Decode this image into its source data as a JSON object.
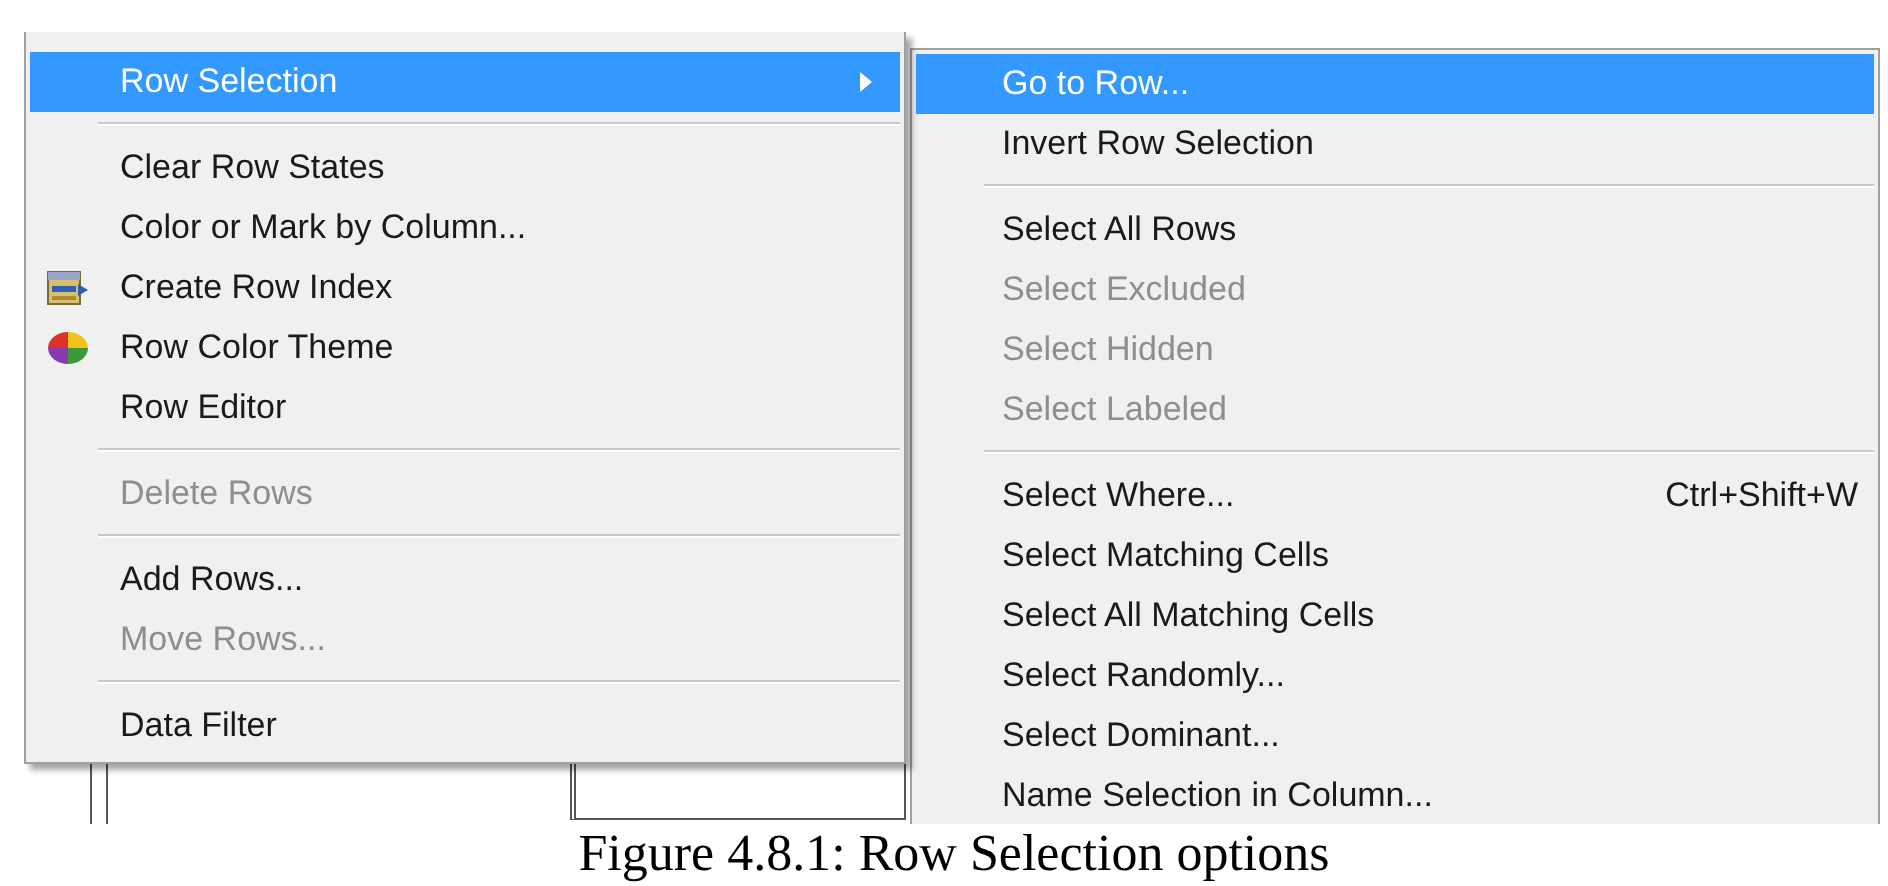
{
  "menu": {
    "items": [
      {
        "kind": "item",
        "label": "Row Selection",
        "selected": true,
        "disabled": false,
        "submenu": true
      },
      {
        "kind": "separator"
      },
      {
        "kind": "item",
        "label": "Clear Row States",
        "selected": false,
        "disabled": false
      },
      {
        "kind": "item",
        "label": "Color or Mark by Column...",
        "selected": false,
        "disabled": false
      },
      {
        "kind": "item",
        "label": "Create Row Index",
        "selected": false,
        "disabled": false
      },
      {
        "kind": "item",
        "label": "Row Color Theme",
        "selected": false,
        "disabled": false
      },
      {
        "kind": "item",
        "label": "Row Editor",
        "selected": false,
        "disabled": false
      },
      {
        "kind": "separator"
      },
      {
        "kind": "item",
        "label": "Delete Rows",
        "selected": false,
        "disabled": true
      },
      {
        "kind": "separator"
      },
      {
        "kind": "item",
        "label": "Add Rows...",
        "selected": false,
        "disabled": false
      },
      {
        "kind": "item",
        "label": "Move Rows...",
        "selected": false,
        "disabled": true
      },
      {
        "kind": "separator"
      },
      {
        "kind": "item",
        "label": "Data Filter",
        "selected": false,
        "disabled": false
      }
    ]
  },
  "submenu": {
    "items": [
      {
        "kind": "item",
        "label": "Go to Row...",
        "selected": true,
        "disabled": false
      },
      {
        "kind": "item",
        "label": "Invert Row Selection",
        "selected": false,
        "disabled": false
      },
      {
        "kind": "separator"
      },
      {
        "kind": "item",
        "label": "Select All Rows",
        "selected": false,
        "disabled": false
      },
      {
        "kind": "item",
        "label": "Select Excluded",
        "selected": false,
        "disabled": true
      },
      {
        "kind": "item",
        "label": "Select Hidden",
        "selected": false,
        "disabled": true
      },
      {
        "kind": "item",
        "label": "Select Labeled",
        "selected": false,
        "disabled": true
      },
      {
        "kind": "separator"
      },
      {
        "kind": "item",
        "label": "Select Where...",
        "selected": false,
        "disabled": false,
        "shortcut": "Ctrl+Shift+W"
      },
      {
        "kind": "item",
        "label": "Select Matching Cells",
        "selected": false,
        "disabled": false
      },
      {
        "kind": "item",
        "label": "Select All Matching Cells",
        "selected": false,
        "disabled": false
      },
      {
        "kind": "item",
        "label": "Select Randomly...",
        "selected": false,
        "disabled": false
      },
      {
        "kind": "item",
        "label": "Select Dominant...",
        "selected": false,
        "disabled": false
      },
      {
        "kind": "item",
        "label": "Name Selection in Column...",
        "selected": false,
        "disabled": false
      }
    ]
  },
  "caption": "Figure 4.8.1: Row Selection options"
}
